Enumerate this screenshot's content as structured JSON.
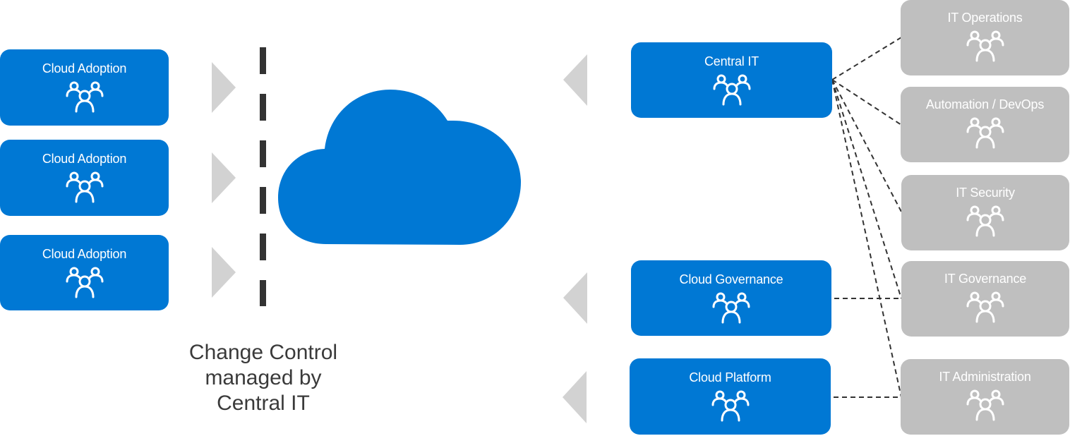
{
  "diagram": {
    "caption": {
      "line1": "Change Control",
      "line2": "managed by",
      "line3": "Central IT"
    },
    "adoption_teams": [
      {
        "label": "Cloud Adoption",
        "icon": "people-group-icon"
      },
      {
        "label": "Cloud Adoption",
        "icon": "people-group-icon"
      },
      {
        "label": "Cloud Adoption",
        "icon": "people-group-icon"
      }
    ],
    "central_teams": [
      {
        "label": "Central IT",
        "icon": "people-group-icon"
      },
      {
        "label": "Cloud Governance",
        "icon": "people-group-icon"
      },
      {
        "label": "Cloud Platform",
        "icon": "people-group-icon"
      }
    ],
    "it_teams": [
      {
        "label": "IT Operations",
        "icon": "people-group-icon"
      },
      {
        "label": "Automation / DevOps",
        "icon": "people-group-icon"
      },
      {
        "label": "IT Security",
        "icon": "people-group-icon"
      },
      {
        "label": "IT Governance",
        "icon": "people-group-icon"
      },
      {
        "label": "IT Administration",
        "icon": "people-group-icon"
      }
    ],
    "center": {
      "icon": "cloud-icon"
    },
    "connections": [
      {
        "from": "Central IT",
        "to": "IT Operations"
      },
      {
        "from": "Central IT",
        "to": "Automation / DevOps"
      },
      {
        "from": "Central IT",
        "to": "IT Security"
      },
      {
        "from": "Central IT",
        "to": "IT Governance"
      },
      {
        "from": "Central IT",
        "to": "IT Administration"
      },
      {
        "from": "Cloud Governance",
        "to": "IT Governance"
      },
      {
        "from": "Cloud Platform",
        "to": "IT Administration"
      }
    ],
    "colors": {
      "team_blue": "#0078d4",
      "team_gray": "#bfbfbf",
      "arrow_gray": "#d2d2d2",
      "dash_dark": "#333333",
      "cloud_blue": "#0078d4"
    }
  }
}
